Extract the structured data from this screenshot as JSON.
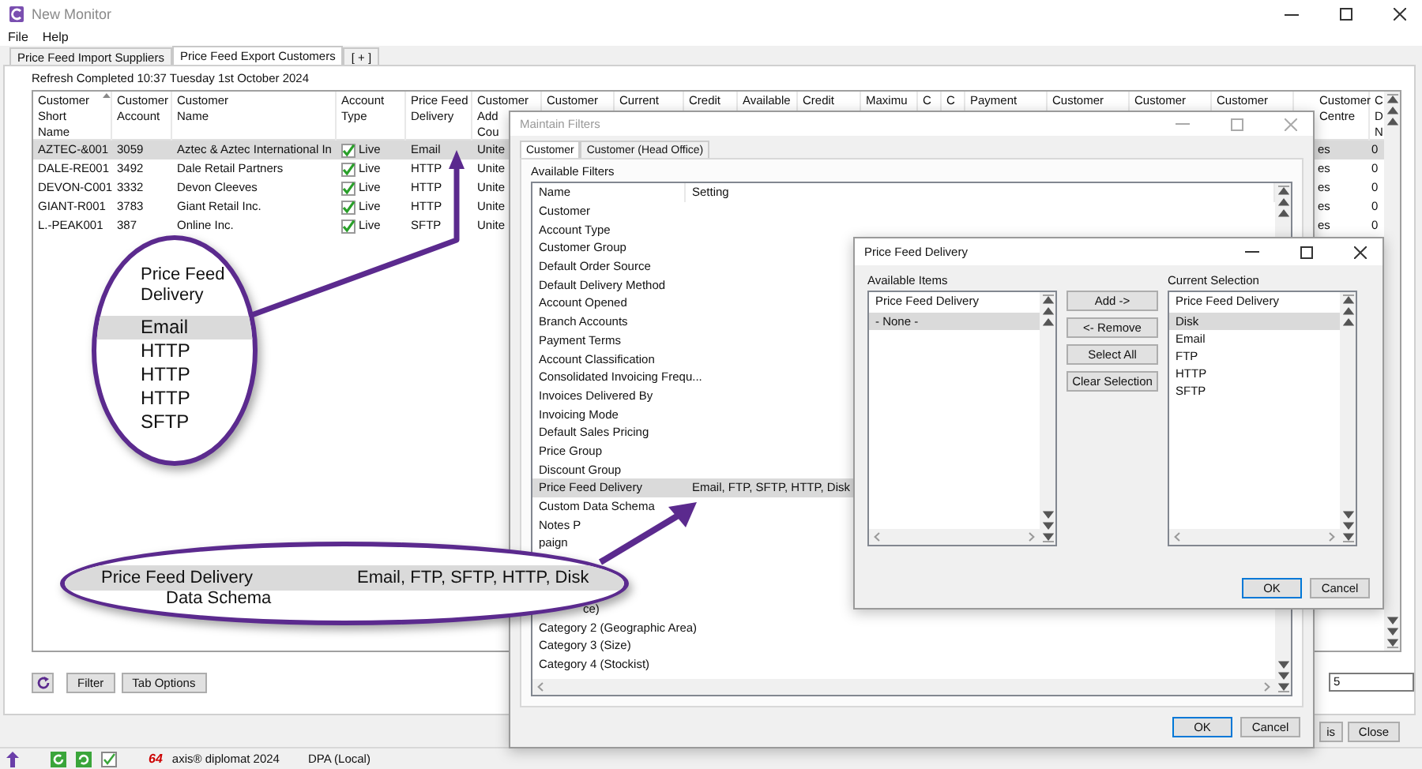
{
  "window": {
    "title": "New Monitor"
  },
  "menu": [
    "File",
    "Help"
  ],
  "tabs": [
    {
      "label": "Price Feed Import Suppliers",
      "selected": false
    },
    {
      "label": "Price Feed Export Customers",
      "selected": true
    },
    {
      "label": "[ + ]",
      "selected": false
    }
  ],
  "refresh_status": "Refresh Completed 10:37 Tuesday 1st October 2024",
  "table": {
    "columns": [
      {
        "label": "Customer\nShort Name",
        "sorted": true
      },
      {
        "label": "Customer\nAccount",
        "sorted": false
      },
      {
        "label": "Customer\nName",
        "sorted": false
      },
      {
        "label": "Account\nType",
        "sorted": false
      },
      {
        "label": "Price Feed\nDelivery",
        "sorted": false
      },
      {
        "label": "Customer\nAdd\nCou",
        "sorted": false
      },
      {
        "label": "Customer",
        "sorted": false
      },
      {
        "label": "Current",
        "sorted": false
      },
      {
        "label": "Credit",
        "sorted": false
      },
      {
        "label": "Available",
        "sorted": false
      },
      {
        "label": "Credit",
        "sorted": false
      },
      {
        "label": "Maximu",
        "sorted": false
      },
      {
        "label": "C",
        "sorted": false
      },
      {
        "label": "C",
        "sorted": false
      },
      {
        "label": "Payment",
        "sorted": false
      },
      {
        "label": "Customer",
        "sorted": false
      },
      {
        "label": "Customer",
        "sorted": false
      },
      {
        "label": "Customer",
        "sorted": false
      },
      {
        "label": "Customer\nCentre",
        "sorted": false
      },
      {
        "label": "C\nD\nN",
        "sorted": false
      }
    ],
    "rows": [
      {
        "short_name": "AZTEC-&001",
        "account": "3059",
        "name": "Aztec & Aztec International In",
        "checked": true,
        "account_type": "Live",
        "price_feed_delivery": "Email",
        "column_6": "Unite",
        "column_19": "es",
        "column_20": "0",
        "selected": true
      },
      {
        "short_name": "DALE-RE001",
        "account": "3492",
        "name": "Dale Retail Partners",
        "checked": true,
        "account_type": "Live",
        "price_feed_delivery": "HTTP",
        "column_6": "Unite",
        "column_19": "es",
        "column_20": "0",
        "selected": false
      },
      {
        "short_name": "DEVON-C001",
        "account": "3332",
        "name": "Devon Cleeves",
        "checked": true,
        "account_type": "Live",
        "price_feed_delivery": "HTTP",
        "column_6": "Unite",
        "column_19": "es",
        "column_20": "0",
        "selected": false
      },
      {
        "short_name": "GIANT-R001",
        "account": "3783",
        "name": "Giant Retail Inc.",
        "checked": true,
        "account_type": "Live",
        "price_feed_delivery": "HTTP",
        "column_6": "Unite",
        "column_19": "es",
        "column_20": "0",
        "selected": false
      },
      {
        "short_name": "L.-PEAK001",
        "account": "387",
        "name": "Online Inc.",
        "checked": true,
        "account_type": "Live",
        "price_feed_delivery": "SFTP",
        "column_6": "Unite",
        "column_19": "es",
        "column_20": "0",
        "selected": false
      }
    ]
  },
  "toolbar": [
    "Filter",
    "Tab Options"
  ],
  "field_value": "5",
  "footer_buttons": [
    "is",
    "Close"
  ],
  "status_bar": {
    "logo_text": "64",
    "product": "axis® diplomat 2024",
    "connection": "DPA (Local)"
  },
  "maintain_filters": {
    "title": "Maintain Filters",
    "tabs": [
      {
        "label": "Customer",
        "selected": true
      },
      {
        "label": "Customer (Head Office)",
        "selected": false
      }
    ],
    "group_label": "Available Filters",
    "columns": [
      "Name",
      "Setting"
    ],
    "rows": [
      {
        "name": "Customer",
        "selected": false
      },
      {
        "name": "Account Type",
        "selected": false
      },
      {
        "name": "Customer Group",
        "selected": false
      },
      {
        "name": "Default Order Source",
        "selected": false
      },
      {
        "name": "Default Delivery Method",
        "selected": false
      },
      {
        "name": "Account Opened",
        "selected": false
      },
      {
        "name": "Branch Accounts",
        "selected": false
      },
      {
        "name": "Payment Terms",
        "selected": false
      },
      {
        "name": "Account Classification",
        "selected": false
      },
      {
        "name": "Consolidated Invoicing Frequ...",
        "selected": false
      },
      {
        "name": "Invoices Delivered By",
        "selected": false
      },
      {
        "name": "Invoicing Mode",
        "selected": false
      },
      {
        "name": "Default Sales Pricing",
        "selected": false
      },
      {
        "name": "Price Group",
        "selected": false
      },
      {
        "name": "Discount Group",
        "selected": false
      },
      {
        "name": "Price Feed Delivery",
        "setting": "Email, FTP, SFTP, HTTP, Disk",
        "selected": true
      },
      {
        "name": "Custom Data Schema",
        "selected": false
      },
      {
        "name": "Notes P",
        "selected": false
      },
      {
        "name": "paign",
        "selected": false
      }
    ],
    "lower_rows": [
      {
        "name": "ce)",
        "selected": false
      },
      {
        "name": "Category 2 (Geographic Area)",
        "selected": false
      },
      {
        "name": "Category 3 (Size)",
        "selected": false
      },
      {
        "name": "Category 4 (Stockist)",
        "selected": false
      }
    ],
    "buttons": [
      {
        "label": "OK",
        "default": true
      },
      {
        "label": "Cancel",
        "default": false
      }
    ]
  },
  "price_feed_dialog": {
    "title": "Price Feed Delivery",
    "available": {
      "label": "Available Items",
      "column": "Price Feed Delivery",
      "items": [
        {
          "label": "- None -",
          "selected": true
        }
      ]
    },
    "actions": [
      "Add ->",
      "<- Remove",
      "Select All",
      "Clear Selection"
    ],
    "current": {
      "label": "Current Selection",
      "column": "Price Feed Delivery",
      "items": [
        {
          "label": "Disk",
          "selected": true
        },
        {
          "label": "Email",
          "selected": false
        },
        {
          "label": "FTP",
          "selected": false
        },
        {
          "label": "HTTP",
          "selected": false
        },
        {
          "label": "SFTP",
          "selected": false
        }
      ]
    },
    "buttons": [
      {
        "label": "OK",
        "default": true
      },
      {
        "label": "Cancel",
        "default": false
      }
    ]
  },
  "callouts": {
    "magnifier": {
      "header": "Price Feed\nDelivery",
      "rows": [
        {
          "label": "Email",
          "selected": true
        },
        {
          "label": "HTTP",
          "selected": false
        },
        {
          "label": "HTTP",
          "selected": false
        },
        {
          "label": "HTTP",
          "selected": false
        },
        {
          "label": "SFTP",
          "selected": false
        }
      ]
    },
    "band": {
      "name": "Price Feed Delivery",
      "setting": "Email, FTP, SFTP, HTTP, Disk",
      "below": "Data Schema"
    }
  }
}
